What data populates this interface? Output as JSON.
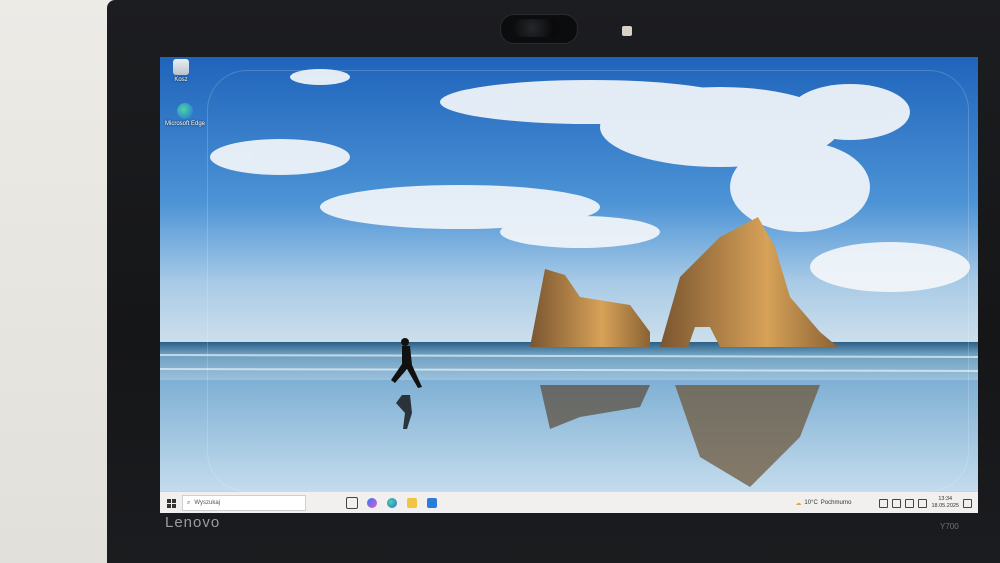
{
  "device": {
    "brand": "Lenovo",
    "model": "Y700"
  },
  "desktop": {
    "icons": [
      {
        "label": "Kosz",
        "icon": "recycle-bin-icon"
      },
      {
        "label": "Microsoft Edge",
        "icon": "edge-icon"
      }
    ]
  },
  "taskbar": {
    "search_placeholder": "Wyszukaj",
    "apps": [
      "task-view-icon",
      "copilot-icon",
      "edge-icon",
      "file-explorer-icon",
      "store-icon"
    ],
    "weather": {
      "temp": "10°C",
      "condition": "Pochmurno"
    },
    "time": "13:34",
    "date": "18.05.2025"
  },
  "colors": {
    "sky": "#2f78cc",
    "sea": "#3f7fa8",
    "rock": "#b8854a",
    "taskbar": "#f1f0ef"
  }
}
